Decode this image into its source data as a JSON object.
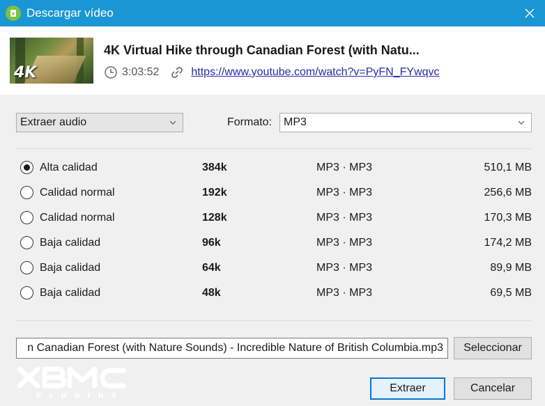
{
  "window": {
    "title": "Descargar vídeo"
  },
  "video": {
    "title": "4K Virtual Hike through Canadian Forest (with Natu...",
    "duration": "3:03:52",
    "url": "https://www.youtube.com/watch?v=PyFN_FYwqvc",
    "thumbnail_badge": "4K"
  },
  "controls": {
    "mode_selected": "Extraer audio",
    "format_label": "Formato:",
    "format_selected": "MP3"
  },
  "qualities": [
    {
      "label": "Alta calidad",
      "bitrate": "384k",
      "format": "MP3 · MP3",
      "size": "510,1 MB",
      "selected": true
    },
    {
      "label": "Calidad normal",
      "bitrate": "192k",
      "format": "MP3 · MP3",
      "size": "256,6 MB",
      "selected": false
    },
    {
      "label": "Calidad normal",
      "bitrate": "128k",
      "format": "MP3 · MP3",
      "size": "170,3 MB",
      "selected": false
    },
    {
      "label": "Baja calidad",
      "bitrate": "96k",
      "format": "MP3 · MP3",
      "size": "174,2 MB",
      "selected": false
    },
    {
      "label": "Baja calidad",
      "bitrate": "64k",
      "format": "MP3 · MP3",
      "size": "89,9 MB",
      "selected": false
    },
    {
      "label": "Baja calidad",
      "bitrate": "48k",
      "format": "MP3 · MP3",
      "size": "69,5 MB",
      "selected": false
    }
  ],
  "output": {
    "filename": "n Canadian Forest (with Nature Sounds) - Incredible Nature of British Columbia.mp3",
    "select_label": "Seleccionar"
  },
  "buttons": {
    "extract_label": "Extraer",
    "cancel_label": "Cancelar"
  },
  "watermark": {
    "brand": "XBMC",
    "sub": "PLUGINS"
  },
  "colors": {
    "titlebar": "#1a96d4",
    "app_icon": "#7bc142",
    "link": "#2a2aa8",
    "focus_border": "#0078d7"
  }
}
